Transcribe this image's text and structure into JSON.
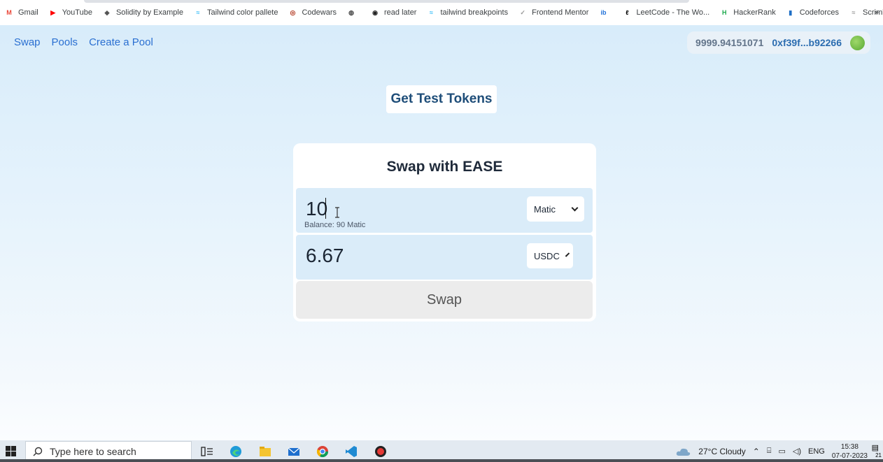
{
  "bookmarks": [
    {
      "label": "Gmail",
      "icon": "gmail-icon",
      "color": "#ea4335"
    },
    {
      "label": "YouTube",
      "icon": "youtube-icon",
      "color": "#ff0000"
    },
    {
      "label": "Solidity by Example",
      "icon": "solidity-icon",
      "color": "#555555"
    },
    {
      "label": "Tailwind color pallete",
      "icon": "tailwind-icon",
      "color": "#38bdf8"
    },
    {
      "label": "Codewars",
      "icon": "codewars-icon",
      "color": "#b1361e"
    },
    {
      "label": "",
      "icon": "globe-icon",
      "color": "#444444"
    },
    {
      "label": "read later",
      "icon": "readlater-icon",
      "color": "#222222"
    },
    {
      "label": "tailwind breakpoints",
      "icon": "tailwind-icon",
      "color": "#38bdf8"
    },
    {
      "label": "Frontend Mentor",
      "icon": "frontendmentor-icon",
      "color": "#999999"
    },
    {
      "label": "",
      "icon": "ibb-icon",
      "color": "#1d6fd8"
    },
    {
      "label": "LeetCode - The Wo...",
      "icon": "leetcode-icon",
      "color": "#000000"
    },
    {
      "label": "HackerRank",
      "icon": "hackerrank-icon",
      "color": "#1ba94c"
    },
    {
      "label": "Codeforces",
      "icon": "codeforces-icon",
      "color": "#1f6fc5"
    },
    {
      "label": "Scrimba",
      "icon": "scrimba-icon",
      "color": "#999999"
    }
  ],
  "bookmarks_more": "»",
  "nav": {
    "swap": "Swap",
    "pools": "Pools",
    "create_pool": "Create a Pool"
  },
  "wallet": {
    "balance": "9999.94151071",
    "address": "0xf39f...b92266"
  },
  "get_tokens_label": "Get Test Tokens",
  "swap_card": {
    "title": "Swap with EASE",
    "from": {
      "amount": "10",
      "balance": "Balance: 90 Matic",
      "token": "Matic"
    },
    "to": {
      "amount": "6.67",
      "token": "USDC"
    },
    "swap_label": "Swap"
  },
  "taskbar": {
    "search_placeholder": "Type here to search",
    "weather": "27°C  Cloudy",
    "lang": "ENG",
    "time": "15:38",
    "date": "07-07-2023",
    "notif_count": "21"
  },
  "colors": {
    "nav_link": "#2a6fd1",
    "address": "#2b6cb0",
    "field_bg": "#daecf9"
  }
}
